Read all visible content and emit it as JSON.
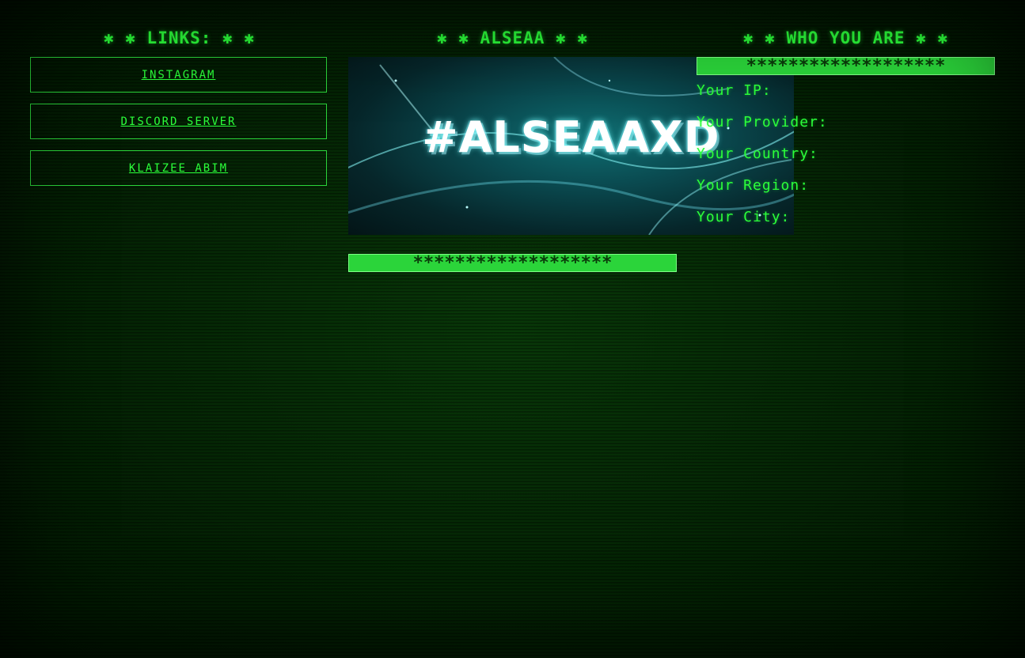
{
  "headings": {
    "links": "✱ ✱ LINKS: ✱ ✱",
    "brand": "✱ ✱ ALSEAA ✱ ✱",
    "who": "✱ ✱ WHO YOU ARE ✱ ✱"
  },
  "links": [
    {
      "label": "INSTAGRAM"
    },
    {
      "label": "DISCORD SERVER"
    },
    {
      "label": "KLAIZEE ABIM"
    }
  ],
  "banner": {
    "text": "#ALSEAAXD"
  },
  "star_bars": {
    "who": "*******************",
    "brand": "*******************"
  },
  "info": {
    "ip": "Your IP:",
    "provider": "Your Provider:",
    "country": "Your Country:",
    "region": "Your Region:",
    "city": "Your City:"
  },
  "colors": {
    "accent": "#2bff3a",
    "background": "#021402",
    "bar": "#2bd43a"
  }
}
